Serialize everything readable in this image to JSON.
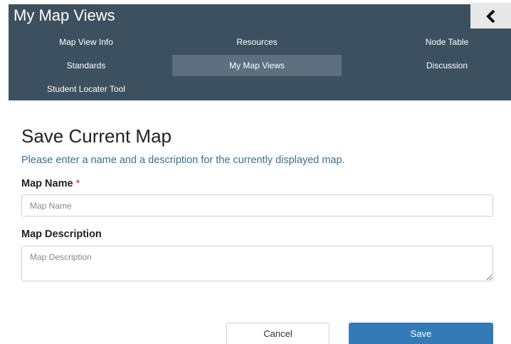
{
  "header": {
    "title": "My Map Views"
  },
  "nav": {
    "items": [
      {
        "label": "Map View Info"
      },
      {
        "label": "Resources"
      },
      {
        "label": "Node Table"
      },
      {
        "label": "Standards"
      },
      {
        "label": "My Map Views",
        "active": true
      },
      {
        "label": "Discussion"
      },
      {
        "label": "Student Locater Tool"
      }
    ]
  },
  "form": {
    "title": "Save Current Map",
    "instruction": "Please enter a name and a description for the currently displayed map.",
    "name_label": "Map Name",
    "required_marker": "*",
    "name_placeholder": "Map Name",
    "description_label": "Map Description",
    "description_placeholder": "Map Description"
  },
  "buttons": {
    "cancel_label": "Cancel",
    "save_label": "Save"
  },
  "colors": {
    "header_bg": "#3d5060",
    "active_tab": "#5d6f7e",
    "primary": "#337ab7",
    "instruction_text": "#3b6f8f"
  },
  "icons": {
    "back": "chevron-left-icon"
  }
}
